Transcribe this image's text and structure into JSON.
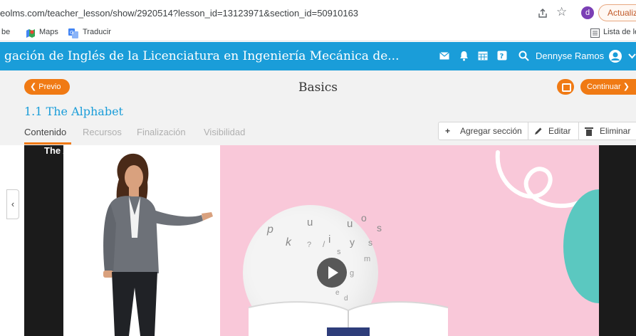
{
  "browser": {
    "url": "eolms.com/teacher_lesson/show/2920514?lesson_id=13123971&section_id=50910163",
    "profile_initial": "d",
    "update_label": "Actualizar",
    "reading_list_label": "Lista de lectura"
  },
  "bookmarks": [
    {
      "label": "be",
      "icon": "bookmark-fragment"
    },
    {
      "label": "Maps",
      "icon": "maps-icon"
    },
    {
      "label": "Traducir",
      "icon": "translate-icon"
    }
  ],
  "header": {
    "course_title": "gación de Inglés de la Licenciatura en Ingeniería Mecánica de...",
    "icons": [
      "mail-icon",
      "bell-icon",
      "calendar-icon",
      "help-icon",
      "search-icon"
    ],
    "user_name": "Dennyse Ramos"
  },
  "lesson": {
    "prev_label": "Previo",
    "title": "Basics",
    "next_label": "Continuar",
    "section_title": "1.1 The Alphabet",
    "tabs": [
      "Contenido",
      "Recursos",
      "Finalización",
      "Visibilidad"
    ],
    "actions": {
      "add_section": "Agregar sección",
      "edit": "Editar",
      "delete": "Eliminar"
    }
  },
  "video": {
    "title": "The Alphabet",
    "letters": [
      "p",
      "u",
      "u",
      "o",
      "s",
      "k",
      "i",
      "y",
      "s",
      "s",
      "g",
      "e",
      "d",
      "?",
      "/",
      "m"
    ]
  },
  "colors": {
    "header_blue": "#1a9dd9",
    "accent_orange": "#f07a14",
    "video_pink": "#f9c8d9",
    "teal_blob": "#5bc8c0"
  }
}
